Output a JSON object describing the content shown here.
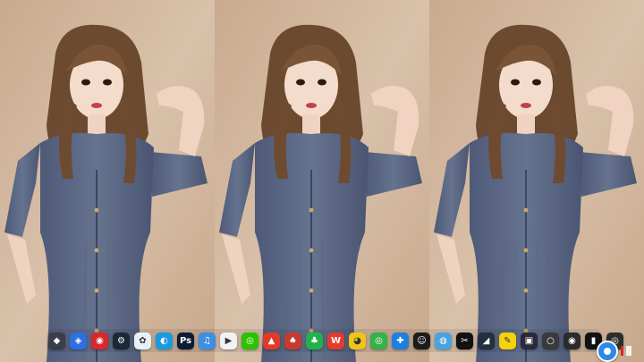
{
  "screen": {
    "background": "#cdb299",
    "panel_count": 3
  },
  "dock": {
    "items": [
      {
        "icon": "app-dark-bird-icon",
        "color": "#3a3d4a",
        "glyph": "◆"
      },
      {
        "icon": "security-shield-icon",
        "color": "#2f6fe0",
        "glyph": "◈"
      },
      {
        "icon": "netease-music-icon",
        "color": "#d8282c",
        "glyph": "◉"
      },
      {
        "icon": "steam-icon",
        "color": "#1b2838",
        "glyph": "⚙"
      },
      {
        "icon": "flower-app-icon",
        "color": "#e8f1f7",
        "glyph": "✿"
      },
      {
        "icon": "edge-browser-icon",
        "color": "#1a9be0",
        "glyph": "◐"
      },
      {
        "icon": "photoshop-icon",
        "color": "#0d1b33",
        "glyph": "Ps"
      },
      {
        "icon": "headphones-icon",
        "color": "#3d8fe3",
        "glyph": "♫"
      },
      {
        "icon": "video-player-icon",
        "color": "#f2f2f2",
        "glyph": "▶"
      },
      {
        "icon": "wechat-icon",
        "color": "#2dc100",
        "glyph": "◎"
      },
      {
        "icon": "pdf-reader-icon",
        "color": "#e03a2a",
        "glyph": "▲"
      },
      {
        "icon": "game-app-icon",
        "color": "#c73a2e",
        "glyph": "♠"
      },
      {
        "icon": "green-leaf-icon",
        "color": "#22b24c",
        "glyph": "♣"
      },
      {
        "icon": "wps-office-icon",
        "color": "#e23b2e",
        "glyph": "W"
      },
      {
        "icon": "chrome-browser-icon",
        "color": "#f0c419",
        "glyph": "◕"
      },
      {
        "icon": "wechat-work-icon",
        "color": "#35b24a",
        "glyph": "◎"
      },
      {
        "icon": "plus-cross-icon",
        "color": "#1f7fe0",
        "glyph": "✚"
      },
      {
        "icon": "qq-icon",
        "color": "#1b1b1b",
        "glyph": "☺"
      },
      {
        "icon": "globe-app-icon",
        "color": "#4aa3e0",
        "glyph": "◍"
      },
      {
        "icon": "capcut-icon",
        "color": "#111111",
        "glyph": "✂"
      },
      {
        "icon": "dark-editor-icon",
        "color": "#22313f",
        "glyph": "◢"
      },
      {
        "icon": "yellow-notes-icon",
        "color": "#f5d20b",
        "glyph": "✎"
      },
      {
        "icon": "media-console-icon",
        "color": "#2a2a3a",
        "glyph": "▣"
      },
      {
        "icon": "circle-tool-icon",
        "color": "#3a3a3a",
        "glyph": "○"
      },
      {
        "icon": "obs-recorder-icon",
        "color": "#2b2b2b",
        "glyph": "◉"
      },
      {
        "icon": "terminal-icon",
        "color": "#111111",
        "glyph": "▮"
      },
      {
        "icon": "lens-app-icon",
        "color": "#2e2e2e",
        "glyph": "◎"
      }
    ]
  },
  "tray": {
    "record_button": {
      "icon": "screen-record-icon",
      "color": "#2b8ae6"
    },
    "stop_marks": [
      "#d22a2a",
      "#f1f1f1"
    ]
  }
}
